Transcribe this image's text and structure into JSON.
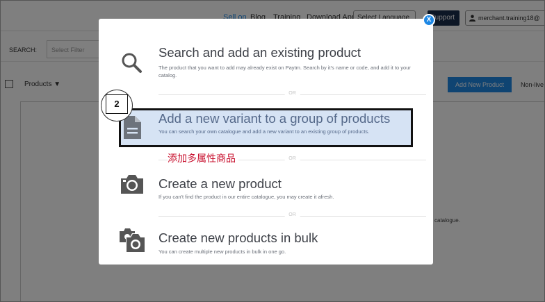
{
  "topnav": {
    "links": [
      "Sell on",
      "Blog",
      "Training",
      "Download App"
    ],
    "language_select": "Select Language",
    "support_label": "Support",
    "merchant_account": "merchant.training18@"
  },
  "search": {
    "label": "SEARCH:",
    "placeholder": "Select Filter"
  },
  "products_bar": {
    "dropdown_label": "Products ▼",
    "add_new_product": "Add New Product",
    "non_live": "Non-live"
  },
  "background_text": "catalogue.",
  "modal": {
    "close_label": "X",
    "or_label": "OR",
    "options": [
      {
        "icon": "search-icon",
        "title": "Search and add an existing product",
        "description": "The product that you want to add may already exist on Paytm. Search by it's name or code, and add it to your catalog."
      },
      {
        "icon": "document-icon",
        "title": "Add a new variant to a group of products",
        "description": "You can search your own catalogue and add a new variant to an existing group of products."
      },
      {
        "icon": "camera-icon",
        "title": "Create a new product",
        "description": "If you can't find the product in our entire catalogue, you may create it afresh."
      },
      {
        "icon": "multi-camera-icon",
        "title": "Create new products in bulk",
        "description": "You can create multiple new products in bulk in one go."
      }
    ]
  },
  "annotation": {
    "step_number": "2",
    "chinese_note": "添加多属性商品"
  },
  "colors": {
    "accent": "#1e88e5",
    "highlight_bg": "#d6e3f4",
    "note_red": "#c8102e"
  }
}
